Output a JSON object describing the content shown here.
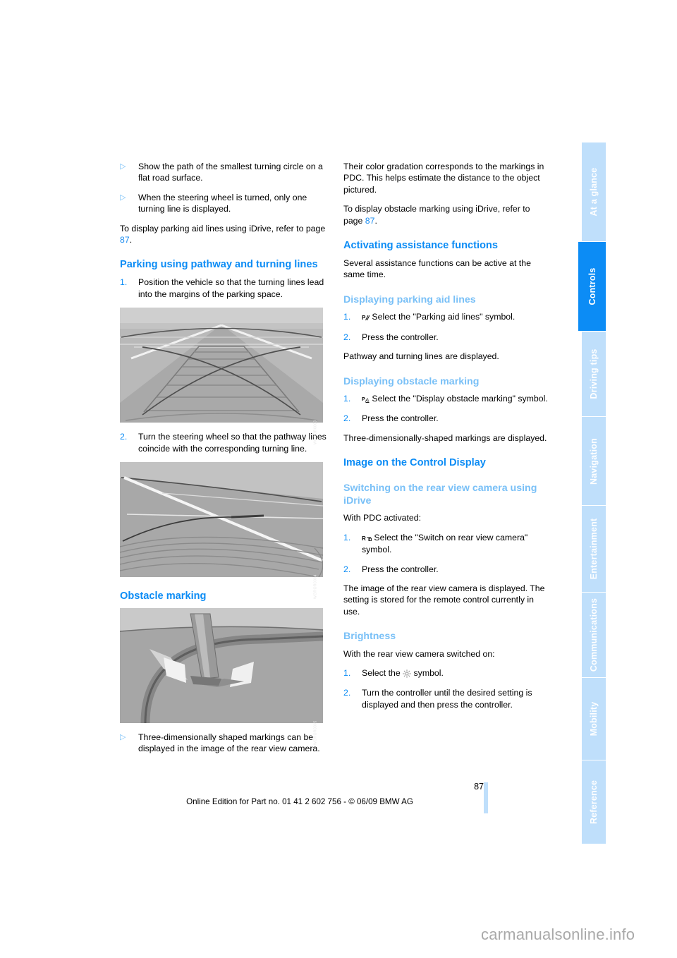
{
  "document": {
    "page_number": "87",
    "edition_line": "Online Edition for Part no. 01 41 2 602 756 - © 06/09 BMW AG",
    "watermark": "carmanualsonline.info",
    "accent_blue": "#0c8cf5",
    "light_blue": "#79c0f7",
    "tab_blue": "#bfdffb"
  },
  "tabs": [
    {
      "label": "At a glance",
      "active": false
    },
    {
      "label": "Controls",
      "active": true
    },
    {
      "label": "Driving tips",
      "active": false
    },
    {
      "label": "Navigation",
      "active": false
    },
    {
      "label": "Entertainment",
      "active": false
    },
    {
      "label": "Communications",
      "active": false
    },
    {
      "label": "Mobility",
      "active": false
    },
    {
      "label": "Reference",
      "active": false
    }
  ],
  "left_column": {
    "bullet_1": "Show the path of the smallest turning circle on a flat road surface.",
    "bullet_2": "When the steering wheel is turned, only one turning line is displayed.",
    "para_1_a": "To display parking aid lines using iDrive, refer to page ",
    "para_1_ref": "87",
    "para_1_b": ".",
    "heading_parking": "Parking using pathway and turning lines",
    "step_1_num": "1.",
    "step_1_text": "Position the vehicle so that the turning lines lead into the margins of the parking space.",
    "figure_1_code": "WGROR0003",
    "step_2_num": "2.",
    "step_2_text": "Turn the steering wheel so that the pathway lines coincide with the corresponding turning line.",
    "figure_2_code": "WGROR0004",
    "heading_obstacle": "Obstacle marking",
    "figure_3_code": "WGROR0005",
    "bullet_3": "Three-dimensionally shaped markings can be displayed in the image of the rear view camera."
  },
  "right_column": {
    "para_1": "Their color gradation corresponds to the markings in PDC. This helps estimate the distance to the object pictured.",
    "para_2_a": "To display obstacle marking using iDrive, refer to page ",
    "para_2_ref": "87",
    "para_2_b": ".",
    "heading_activating": "Activating assistance functions",
    "para_3": "Several assistance functions can be active at the same time.",
    "heading_parking_aid": "Displaying parking aid lines",
    "paid_step_1_num": "1.",
    "paid_step_1_text": "Select the \"Parking aid lines\" symbol.",
    "paid_step_1_icon": "parking-aid-lines-symbol",
    "paid_step_2_num": "2.",
    "paid_step_2_text": "Press the controller.",
    "para_4": "Pathway and turning lines are displayed.",
    "heading_obstacle_marking": "Displaying obstacle marking",
    "obs_step_1_num": "1.",
    "obs_step_1_text": "Select the \"Display obstacle marking\" symbol.",
    "obs_step_1_icon": "obstacle-marking-symbol",
    "obs_step_2_num": "2.",
    "obs_step_2_text": "Press the controller.",
    "para_5": "Three-dimensionally-shaped markings are displayed.",
    "heading_image_control": "Image on the Control Display",
    "heading_switching": "Switching on the rear view camera using iDrive",
    "para_6": "With PDC activated:",
    "sw_step_1_num": "1.",
    "sw_step_1_text": "Select the \"Switch on rear view camera\" symbol.",
    "sw_step_1_icon": "rear-view-camera-symbol",
    "sw_step_2_num": "2.",
    "sw_step_2_text": "Press the controller.",
    "para_7": "The image of the rear view camera is displayed. The setting is stored for the remote control currently in use.",
    "heading_brightness": "Brightness",
    "para_8": "With the rear view camera switched on:",
    "br_step_1_num": "1.",
    "br_step_1_a": "Select the ",
    "br_step_1_b": " symbol.",
    "br_step_1_icon": "brightness-sun-symbol",
    "br_step_2_num": "2.",
    "br_step_2_text": "Turn the controller until the desired setting is displayed and then press the controller."
  }
}
